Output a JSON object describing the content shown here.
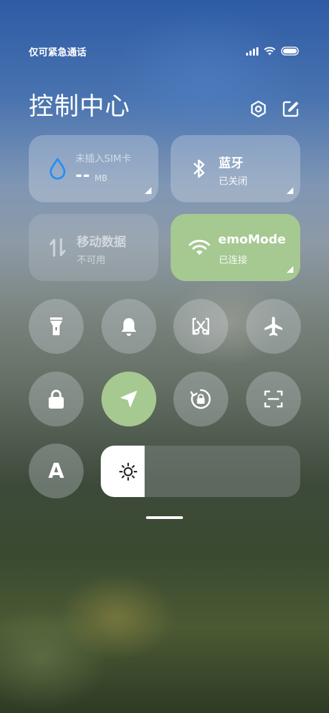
{
  "status_bar": {
    "carrier_text": "仅可紧急通话"
  },
  "header": {
    "title": "控制中心"
  },
  "tiles": {
    "sim": {
      "title": "未插入SIM卡",
      "value": "--",
      "unit": "MB"
    },
    "bluetooth": {
      "title": "蓝牙",
      "status": "已关闭"
    },
    "mobile_data": {
      "title": "移动数据",
      "status": "不可用"
    },
    "wifi": {
      "title": "DemoMode",
      "status": "已连接"
    }
  },
  "toggles": [
    {
      "name": "flashlight",
      "icon": "flashlight-icon",
      "active": false
    },
    {
      "name": "notifications",
      "icon": "bell-icon",
      "active": false
    },
    {
      "name": "screenshot",
      "icon": "scissors-icon",
      "active": false
    },
    {
      "name": "airplane-mode",
      "icon": "airplane-icon",
      "active": false
    },
    {
      "name": "lock-screen",
      "icon": "lock-icon",
      "active": false
    },
    {
      "name": "location",
      "icon": "navigation-arrow-icon",
      "active": true
    },
    {
      "name": "rotation-lock",
      "icon": "rotation-lock-icon",
      "active": false
    },
    {
      "name": "scanner",
      "icon": "scan-icon",
      "active": false
    }
  ],
  "auto_brightness": {
    "label": "A"
  },
  "brightness": {
    "level_percent": 22
  },
  "colors": {
    "accent_green": "#a5c991",
    "sim_drop_blue": "#2b8ff0"
  }
}
